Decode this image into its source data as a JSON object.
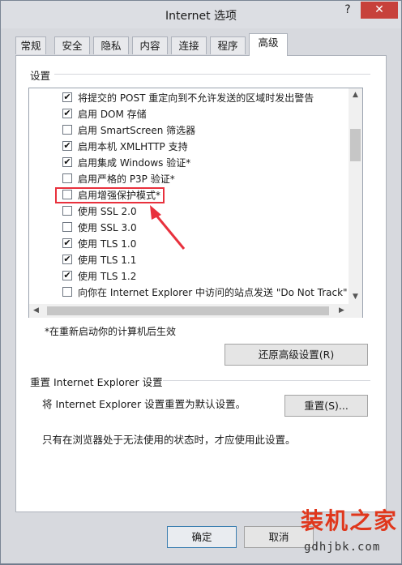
{
  "window": {
    "title": "Internet 选项",
    "help": "?",
    "close": "✕"
  },
  "tabs": [
    {
      "label": "常规"
    },
    {
      "label": "安全"
    },
    {
      "label": "隐私"
    },
    {
      "label": "内容"
    },
    {
      "label": "连接"
    },
    {
      "label": "程序"
    },
    {
      "label": "高级"
    }
  ],
  "active_tab": "高级",
  "settings_group": {
    "title": "设置"
  },
  "options": [
    {
      "label": "将提交的 POST 重定向到不允许发送的区域时发出警告",
      "checked": true
    },
    {
      "label": "启用 DOM 存储",
      "checked": true
    },
    {
      "label": "启用 SmartScreen 筛选器",
      "checked": false
    },
    {
      "label": "启用本机 XMLHTTP 支持",
      "checked": true
    },
    {
      "label": "启用集成 Windows 验证*",
      "checked": true
    },
    {
      "label": "启用严格的 P3P 验证*",
      "checked": false
    },
    {
      "label": "启用增强保护模式*",
      "checked": false
    },
    {
      "label": "使用 SSL 2.0",
      "checked": false
    },
    {
      "label": "使用 SSL 3.0",
      "checked": false
    },
    {
      "label": "使用 TLS 1.0",
      "checked": true
    },
    {
      "label": "使用 TLS 1.1",
      "checked": true
    },
    {
      "label": "使用 TLS 1.2",
      "checked": true
    },
    {
      "label": "向你在 Internet Explorer 中访问的站点发送 \"Do Not Track\"",
      "checked": false
    }
  ],
  "restart_note": "*在重新启动你的计算机后生效",
  "restore_button": "还原高级设置(R)",
  "reset_group": {
    "title": "重置 Internet Explorer 设置",
    "description": "将 Internet Explorer 设置重置为默认设置。",
    "button": "重置(S)...",
    "note": "只有在浏览器处于无法使用的状态时，才应使用此设置。"
  },
  "footer": {
    "ok": "确定",
    "cancel": "取消"
  },
  "watermark": {
    "logo": "装机之家",
    "url": "gdhjbk.com"
  }
}
